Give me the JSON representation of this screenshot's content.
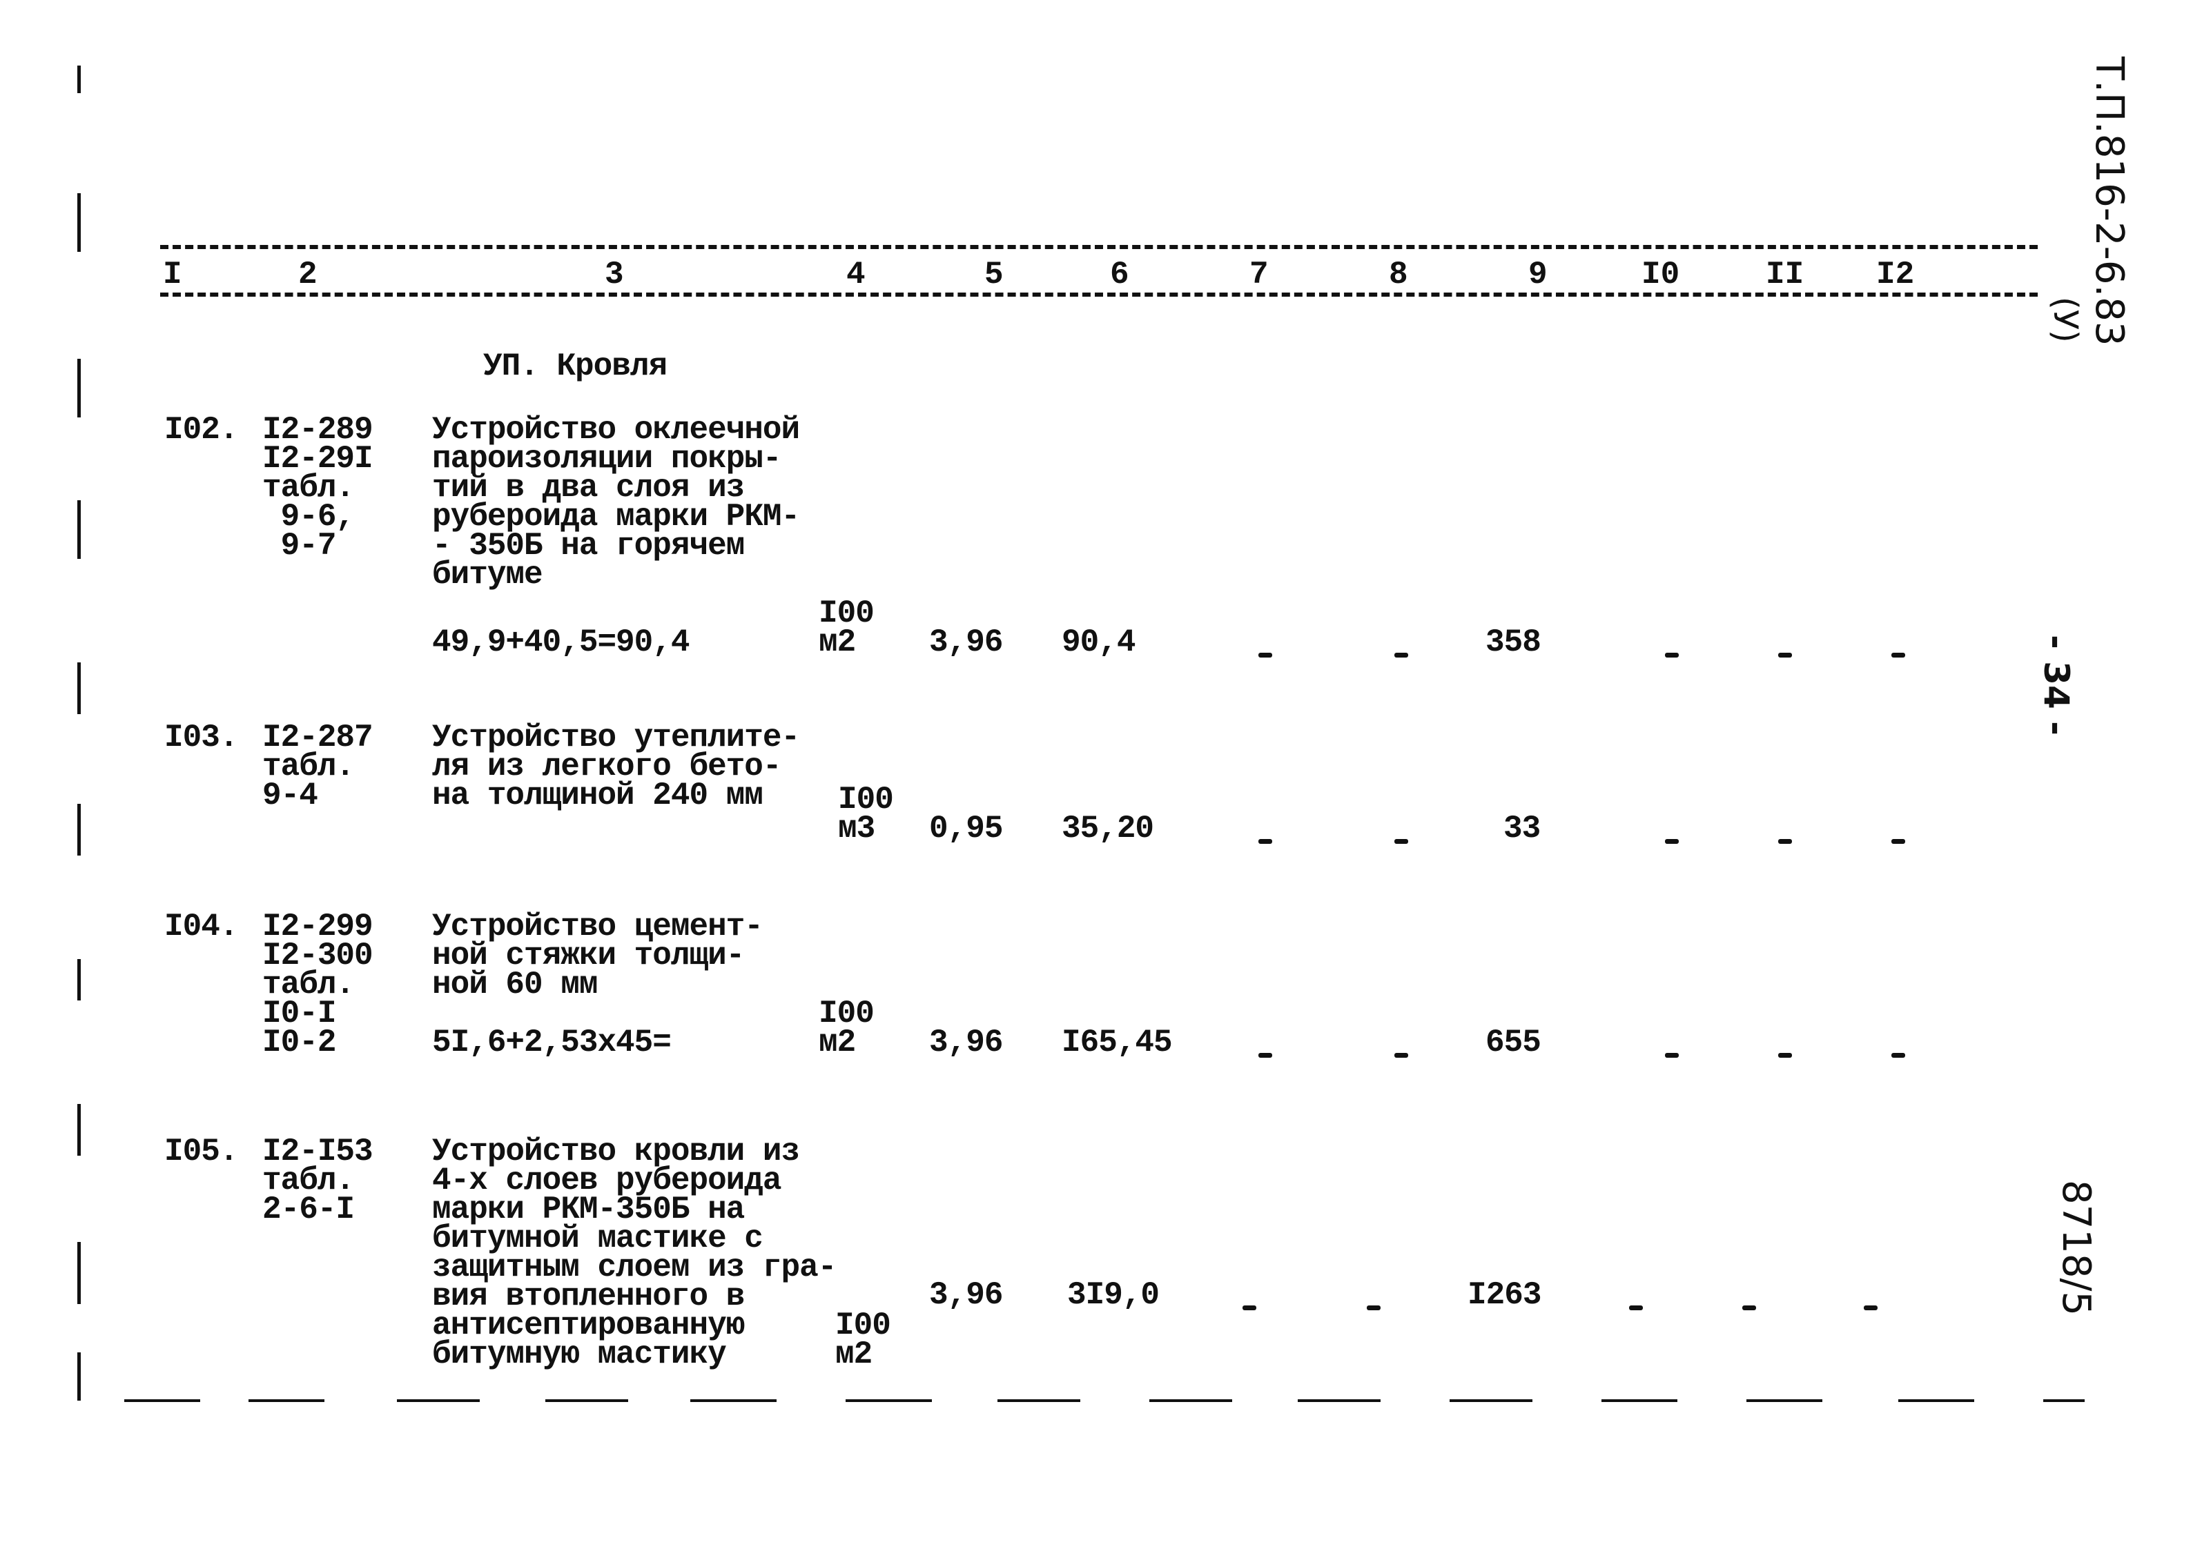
{
  "document": {
    "side_code": "Т.П.816-2-6.83",
    "side_code_suffix": "(У)",
    "page_number": "- 34 -",
    "archive_number": "8718/5"
  },
  "table": {
    "column_numbers": [
      "I",
      "2",
      "3",
      "4",
      "5",
      "6",
      "7",
      "8",
      "9",
      "I0",
      "II",
      "I2"
    ],
    "section_title": "УП. Кровля",
    "rows": [
      {
        "num": "I02.",
        "codes": [
          "I2-289",
          "I2-29I",
          "табл.",
          " 9-6,",
          " 9-7"
        ],
        "description": [
          "Устройство оклеечной",
          "пароизоляции покры-",
          "тий в два слоя из",
          "рубероида марки РКМ-",
          "- 350Б на горячем",
          "битуме"
        ],
        "calculation": "49,9+40,5=90,4",
        "unit": [
          "I00",
          "м2"
        ],
        "col5": "3,96",
        "col6": "90,4",
        "col7": "-",
        "col8": "-",
        "col9": "358",
        "col10": "-",
        "col11": "-",
        "col12": "-"
      },
      {
        "num": "I03.",
        "codes": [
          "I2-287",
          "табл.",
          "9-4"
        ],
        "description": [
          "Устройство утеплите-",
          "ля из легкого бето-",
          "на толщиной 240 мм"
        ],
        "calculation": "",
        "unit": [
          "I00",
          "м3"
        ],
        "col5": "0,95",
        "col6": "35,20",
        "col7": "-",
        "col8": "-",
        "col9": "33",
        "col10": "-",
        "col11": "-",
        "col12": "-"
      },
      {
        "num": "I04.",
        "codes": [
          "I2-299",
          "I2-300",
          "табл.",
          "I0-I",
          "I0-2"
        ],
        "description": [
          "Устройство цемент-",
          "ной стяжки толщи-",
          "ной 60 мм"
        ],
        "calculation": "5I,6+2,53x45=",
        "unit": [
          "I00",
          "м2"
        ],
        "col5": "3,96",
        "col6": "I65,45",
        "col7": "-",
        "col8": "-",
        "col9": "655",
        "col10": "-",
        "col11": "-",
        "col12": "-"
      },
      {
        "num": "I05.",
        "codes": [
          "I2-I53",
          "табл.",
          "2-6-I"
        ],
        "description": [
          "Устройство кровли из",
          "4-х слоев рубероида",
          "марки РКМ-350Б на",
          "битумной мастике с",
          "защитным слоем из гра-",
          "вия втопленного в",
          "антисептированную",
          "битумную мастику"
        ],
        "calculation": "",
        "unit": [
          "I00",
          "м2"
        ],
        "col5": "3,96",
        "col6": "3I9,0",
        "col7": "-",
        "col8": "-",
        "col9": "I263",
        "col10": "-",
        "col11": "-",
        "col12": "-"
      }
    ]
  }
}
